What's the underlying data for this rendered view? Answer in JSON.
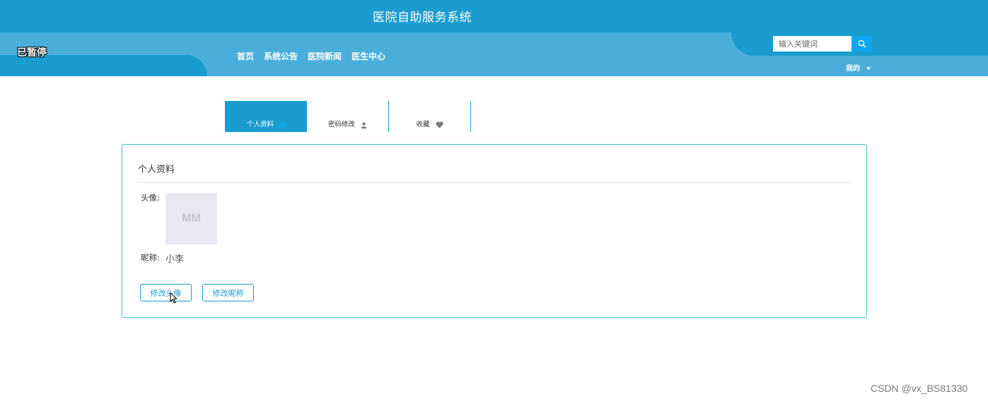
{
  "header": {
    "title": "医院自助服务系统",
    "paused_label": "已暂停",
    "nav": [
      "首页",
      "系统公告",
      "医院新闻",
      "医生中心"
    ],
    "search_placeholder": "输入关键词",
    "mine_label": "我的"
  },
  "tabs": [
    {
      "label": "个人资料",
      "icon": "droplet-icon",
      "active": true
    },
    {
      "label": "密码修改",
      "icon": "user-icon",
      "active": false
    },
    {
      "label": "收藏",
      "icon": "heart-icon",
      "active": false
    }
  ],
  "profile": {
    "title": "个人资料",
    "avatar_label": "头像:",
    "avatar_placeholder": "MM",
    "nickname_label": "昵称:",
    "nickname": "小李",
    "edit_avatar_button": "修改头像",
    "edit_nickname_button": "修改昵称"
  },
  "watermark": "CSDN @vx_BS81330",
  "colors": {
    "primary": "#1b9ccf",
    "nav_band": "#4aaedb",
    "search_button": "#0fa6f0",
    "panel_border": "#3cc4c4",
    "avatar_bg": "#e8e8f3"
  }
}
